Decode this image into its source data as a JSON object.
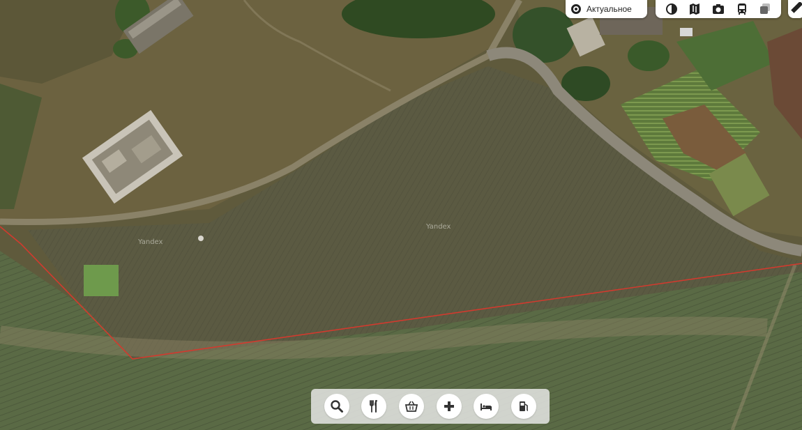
{
  "map": {
    "type": "satellite",
    "watermarks": [
      "Yandex",
      "Yandex"
    ],
    "boundary_color": "#d23a2e"
  },
  "layer_selector": {
    "label": "Актуальное",
    "icon": "target-icon"
  },
  "map_tools": [
    {
      "name": "panorama-icon"
    },
    {
      "name": "map-book-icon"
    },
    {
      "name": "camera-icon"
    },
    {
      "name": "bus-icon"
    },
    {
      "name": "layers-icon"
    },
    {
      "name": "ruler-icon"
    }
  ],
  "poi_buttons": [
    {
      "name": "search-icon"
    },
    {
      "name": "restaurant-icon"
    },
    {
      "name": "shopping-basket-icon"
    },
    {
      "name": "medical-plus-icon"
    },
    {
      "name": "hotel-bed-icon"
    },
    {
      "name": "fuel-station-icon"
    }
  ]
}
